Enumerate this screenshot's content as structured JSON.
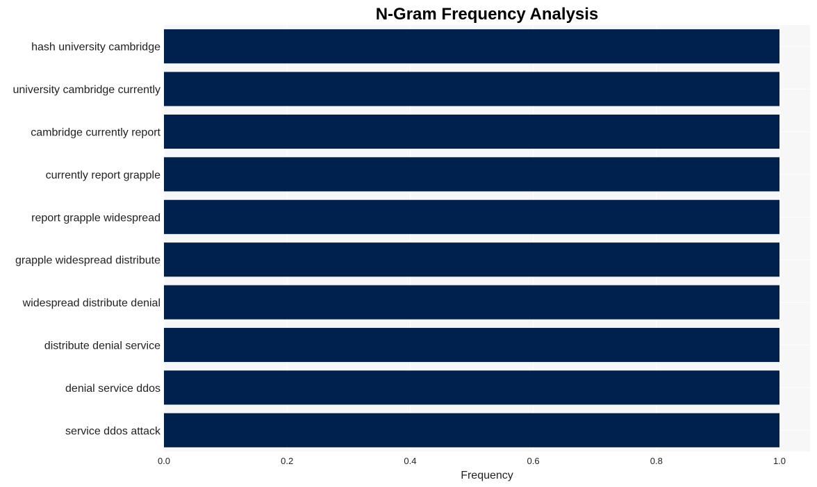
{
  "chart_data": {
    "type": "bar",
    "orientation": "horizontal",
    "title": "N-Gram Frequency Analysis",
    "xlabel": "Frequency",
    "ylabel": "",
    "xlim": [
      0,
      1.05
    ],
    "xticks": [
      0.0,
      0.2,
      0.4,
      0.6,
      0.8,
      1.0
    ],
    "xtick_labels": [
      "0.0",
      "0.2",
      "0.4",
      "0.6",
      "0.8",
      "1.0"
    ],
    "grid": true,
    "bar_color": "#00204e",
    "background_color": "#f7f7f7",
    "categories": [
      "hash university cambridge",
      "university cambridge currently",
      "cambridge currently report",
      "currently report grapple",
      "report grapple widespread",
      "grapple widespread distribute",
      "widespread distribute denial",
      "distribute denial service",
      "denial service ddos",
      "service ddos attack"
    ],
    "values": [
      1,
      1,
      1,
      1,
      1,
      1,
      1,
      1,
      1,
      1
    ]
  }
}
